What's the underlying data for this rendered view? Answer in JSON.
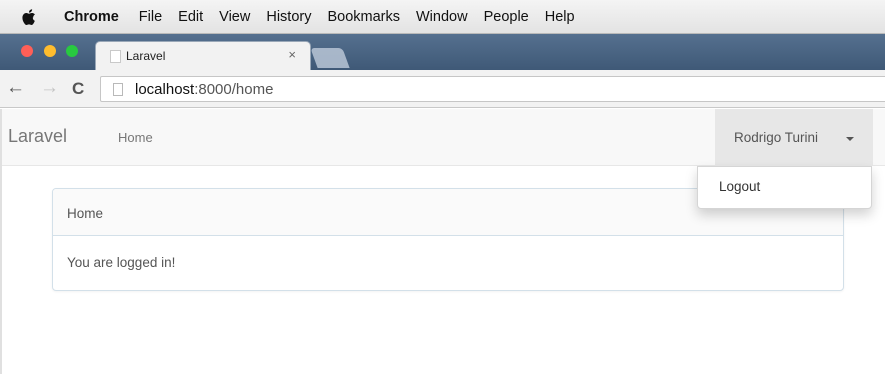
{
  "menubar": {
    "app_name": "Chrome",
    "items": [
      "File",
      "Edit",
      "View",
      "History",
      "Bookmarks",
      "Window",
      "People",
      "Help"
    ]
  },
  "browser": {
    "tab_title": "Laravel",
    "tab_close": "×",
    "url_host": "localhost",
    "url_path": ":8000/home"
  },
  "app": {
    "brand": "Laravel",
    "nav_home": "Home",
    "user_name": "Rodrigo Turini",
    "dropdown_item": "Logout",
    "panel_heading": "Home",
    "panel_body": "You are logged in!"
  },
  "colors": {
    "tabstrip": "#4a6585",
    "navbar_bg": "#f8f8f8",
    "active_menu_bg": "#e7e7e7",
    "panel_border": "#d3e0e9"
  }
}
